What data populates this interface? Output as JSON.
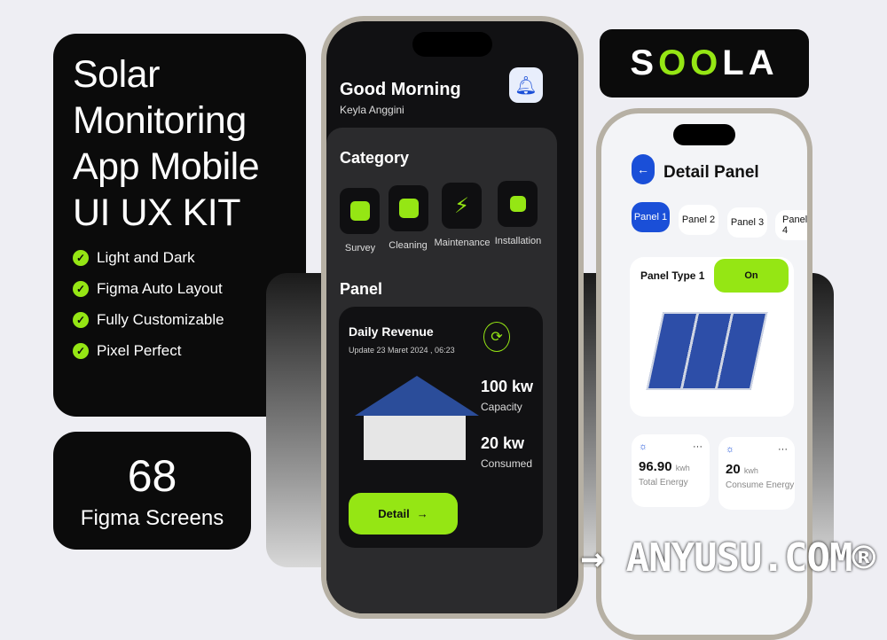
{
  "hero": {
    "title_lines": [
      "Solar",
      "Monitoring",
      "App Mobile",
      "UI UX KIT"
    ],
    "features": [
      "Light and Dark",
      "Figma Auto Layout",
      "Fully Customizable",
      "Pixel Perfect"
    ]
  },
  "count": {
    "number": "68",
    "label": "Figma Screens"
  },
  "logo": {
    "text": "SOOLA"
  },
  "colors": {
    "accent": "#95e614",
    "blue": "#1a4fd8",
    "dark": "#111113"
  },
  "phone1": {
    "greeting": "Good Morning",
    "user": "Keyla Anggini",
    "category_title": "Category",
    "categories": [
      {
        "label": "Survey",
        "icon": "survey-icon"
      },
      {
        "label": "Cleaning",
        "icon": "cleaning-icon"
      },
      {
        "label": "Maintenance",
        "icon": "lightning-icon"
      },
      {
        "label": "Installation",
        "icon": "battery-charging-icon"
      }
    ],
    "panel_title": "Panel",
    "card": {
      "title": "Daily Revenue",
      "updated": "Update 23 Maret 2024 , 06:23",
      "capacity_value": "100 kw",
      "capacity_label": "Capacity",
      "consumed_value": "20 kw",
      "consumed_label": "Consumed",
      "button": "Detail"
    }
  },
  "phone2": {
    "title": "Detail Panel",
    "tabs": [
      "Panel 1",
      "Panel 2",
      "Panel 3",
      "Panel 4"
    ],
    "active_tab": 0,
    "panel_type": "Panel Type 1",
    "status": "On",
    "stats": [
      {
        "value": "96.90",
        "unit": "kwh",
        "label": "Total Energy"
      },
      {
        "value": "20",
        "unit": "kwh",
        "label": "Consume Energy"
      }
    ]
  },
  "watermark": "→ ANYUSU.COM®"
}
